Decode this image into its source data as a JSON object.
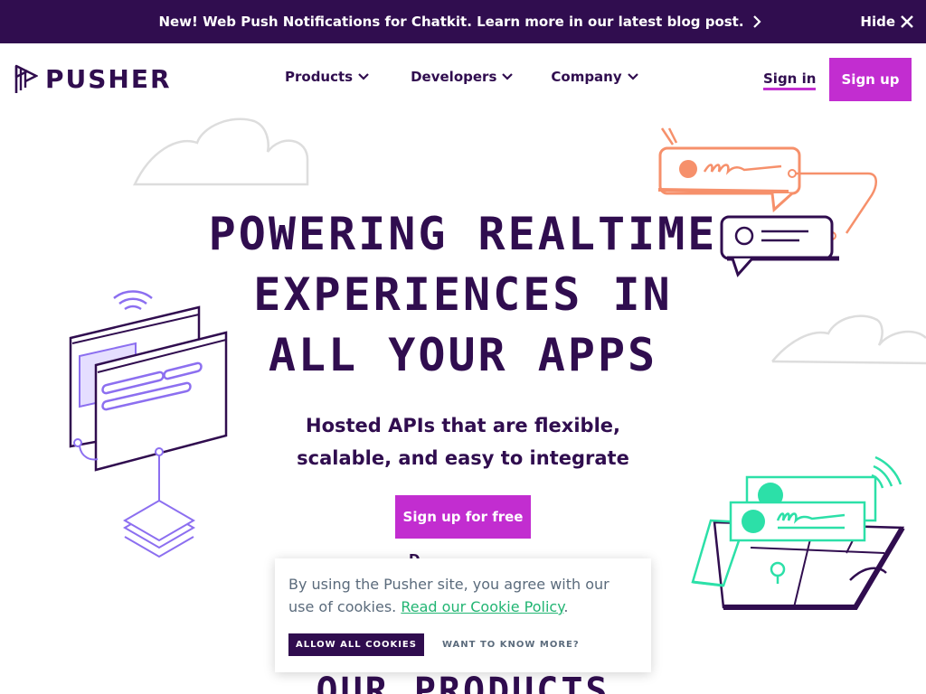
{
  "banner": {
    "text": "New! Web Push Notifications for Chatkit. Learn more in our latest blog post.",
    "hide_label": "Hide"
  },
  "header": {
    "logo_text": "PUSHER",
    "nav": [
      {
        "label": "Products"
      },
      {
        "label": "Developers"
      },
      {
        "label": "Company"
      }
    ],
    "sign_in": "Sign in",
    "sign_up": "Sign up"
  },
  "hero": {
    "title_lines": [
      "POWERING REALTIME",
      "EXPERIENCES IN",
      "ALL YOUR APPS"
    ],
    "subtitle_lines": [
      "Hosted APIs that are flexible,",
      "scalable, and easy to integrate"
    ],
    "cta": "Sign up for free",
    "partial_text": "D",
    "products_heading": "OUR PRODUCTS"
  },
  "cookie": {
    "text": "By using the Pusher site, you agree with our use of cookies.",
    "link_text": "Read our Cookie Policy",
    "trailing": ".",
    "allow_label": "ALLOW ALL COOKIES",
    "more_label": "WANT TO KNOW MORE?"
  },
  "colors": {
    "brand_dark": "#300D4F",
    "accent": "#C22DD0",
    "coral": "#F6906B",
    "lilac": "#8C6FF0",
    "mint": "#2CE0A8",
    "link_green": "#22B573"
  }
}
